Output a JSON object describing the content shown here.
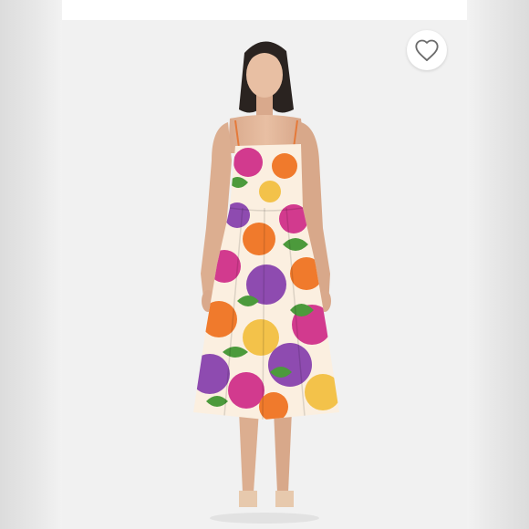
{
  "listing": {
    "photo": {
      "subject": "model-in-floral-midi-dress",
      "background_color": "#f1f1f1",
      "dress_colors": [
        "#d23a8e",
        "#f07a2c",
        "#8e4bb0",
        "#4c9a3c",
        "#f3c24a",
        "#fbefe0"
      ]
    },
    "like_button": {
      "icon": "heart-icon",
      "state": "not-liked"
    }
  }
}
